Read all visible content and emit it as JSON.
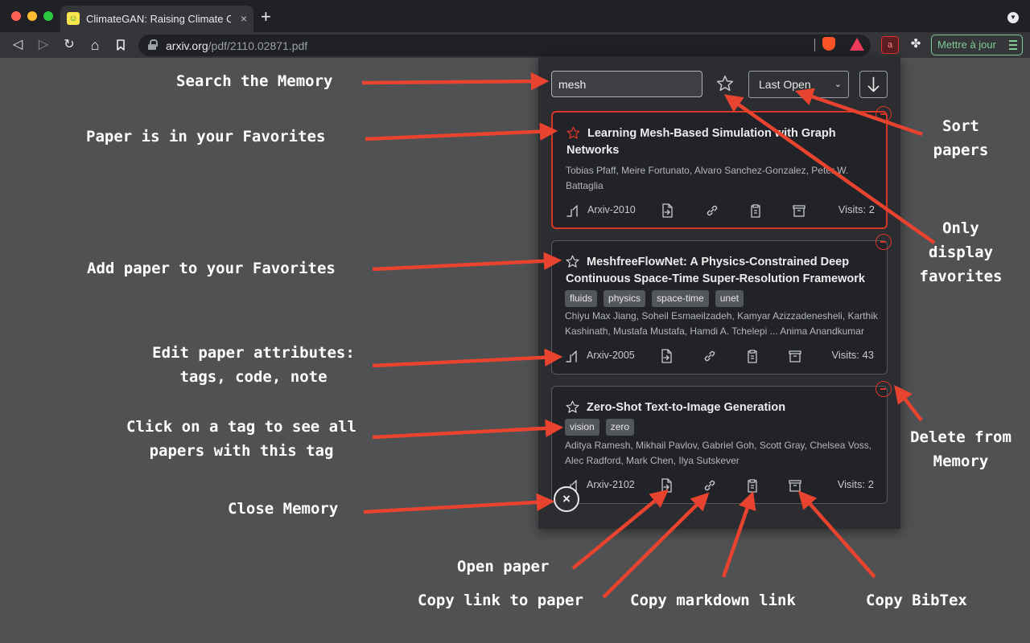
{
  "browser": {
    "tab_title": "ClimateGAN: Raising Climate Cl",
    "tab_favicon_glyph": "☺",
    "url_host": "arxiv.org",
    "url_path": "/pdf/2110.02871.pdf",
    "ext_label": "a",
    "update_label": "Mettre à jour",
    "new_tab_glyph": "+",
    "tab_close_glyph": "×",
    "tab_menu_glyph": "▼",
    "back_glyph": "◁",
    "forward_glyph": "▷",
    "reload_glyph": "↻",
    "home_glyph": "⌂",
    "puzzle_glyph": "✤"
  },
  "memory": {
    "search_value": "mesh",
    "search_placeholder": "",
    "sort_selected": "Last Open",
    "sort_chevron": "⌄",
    "close_glyph": "×",
    "papers": [
      {
        "title": "Learning Mesh-Based Simulation with Graph Networks",
        "authors": "Tobias Pfaff, Meire Fortunato, Alvaro Sanchez-Gonzalez, Peter W. Battaglia",
        "tags": [],
        "venue": "Arxiv-2010",
        "visits": "Visits: 2",
        "favorite": true
      },
      {
        "title": "MeshfreeFlowNet: A Physics-Constrained Deep Continuous Space-Time Super-Resolution Framework",
        "authors": "Chiyu Max Jiang, Soheil Esmaeilzadeh, Kamyar Azizzadenesheli, Karthik Kashinath, Mustafa Mustafa, Hamdi A. Tchelepi ... Anima Anandkumar",
        "tags": [
          "fluids",
          "physics",
          "space-time",
          "unet"
        ],
        "venue": "Arxiv-2005",
        "visits": "Visits: 43",
        "favorite": false
      },
      {
        "title": "Zero-Shot Text-to-Image Generation",
        "authors": "Aditya Ramesh, Mikhail Pavlov, Gabriel Goh, Scott Gray, Chelsea Voss, Alec Radford, Mark Chen, Ilya Sutskever",
        "tags": [
          "vision",
          "zero"
        ],
        "venue": "Arxiv-2102",
        "visits": "Visits: 2",
        "favorite": false
      }
    ]
  },
  "annotations": {
    "search": "Search the Memory",
    "favorites": "Paper is in your Favorites",
    "add_fav": "Add paper to your Favorites",
    "edit_line1": "Edit paper attributes:",
    "edit_line2": "tags, code, note",
    "tag_line1": "Click on a tag to see all",
    "tag_line2": "papers with this tag",
    "close": "Close Memory",
    "open_paper": "Open paper",
    "copy_link": "Copy link to paper",
    "copy_md": "Copy markdown link",
    "copy_bibtex": "Copy BibTex",
    "sort_line1": "Sort",
    "sort_line2": "papers",
    "only_line1": "Only",
    "only_line2": "display",
    "only_line3": "favorites",
    "delete_line1": "Delete from",
    "delete_line2": "Memory"
  },
  "colors": {
    "accent_red": "#d9362a",
    "arrow_red": "#e8432f",
    "panel_bg": "#2b2d31",
    "card_bg": "#212328",
    "page_bg": "#4f5153"
  }
}
